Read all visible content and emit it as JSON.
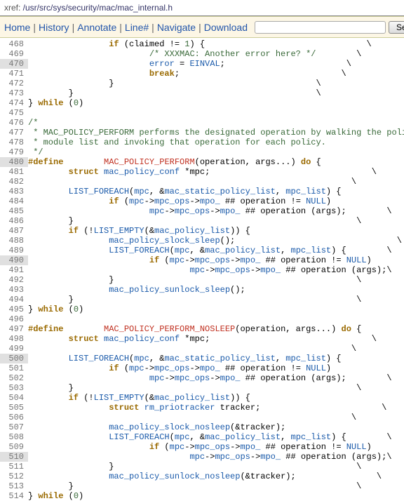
{
  "xref_label": "xref: ",
  "xref_path": "/usr/src/sys/security/mac/mac_internal.h",
  "nav": {
    "home": "Home",
    "history": "History",
    "annotate": "Annotate",
    "linenum": "Line#",
    "navigate": "Navigate",
    "download": "Download",
    "search_btn": "Search",
    "search_placeholder": ""
  },
  "highlight_lines": [
    470,
    480,
    490,
    500,
    510
  ],
  "lines": [
    {
      "n": 468,
      "segs": [
        {
          "t": "\t\t",
          "c": "d"
        },
        {
          "t": "if",
          "c": "k"
        },
        {
          "t": " (claimed != ",
          "c": "d"
        },
        {
          "t": "1",
          "c": "n"
        },
        {
          "t": ") {\t\t\t\t\\",
          "c": "d"
        }
      ]
    },
    {
      "n": 469,
      "segs": [
        {
          "t": "\t\t\t",
          "c": "d"
        },
        {
          "t": "/* XXXMAC: Another error here? */",
          "c": "c"
        },
        {
          "t": "\t\\",
          "c": "d"
        }
      ]
    },
    {
      "n": 470,
      "segs": [
        {
          "t": "\t\t\t",
          "c": "d"
        },
        {
          "t": "error",
          "c": "id"
        },
        {
          "t": " = ",
          "c": "d"
        },
        {
          "t": "EINVAL",
          "c": "id"
        },
        {
          "t": ";\t\t\t\\",
          "c": "d"
        }
      ]
    },
    {
      "n": 471,
      "segs": [
        {
          "t": "\t\t\t",
          "c": "d"
        },
        {
          "t": "break",
          "c": "k"
        },
        {
          "t": ";\t\t\t\t\\",
          "c": "d"
        }
      ]
    },
    {
      "n": 472,
      "segs": [
        {
          "t": "\t\t}\t\t\t\t\t\\",
          "c": "d"
        }
      ]
    },
    {
      "n": 473,
      "segs": [
        {
          "t": "\t}\t\t\t\t\t\t\\",
          "c": "d"
        }
      ]
    },
    {
      "n": 474,
      "segs": [
        {
          "t": "} ",
          "c": "d"
        },
        {
          "t": "while",
          "c": "k"
        },
        {
          "t": " (",
          "c": "d"
        },
        {
          "t": "0",
          "c": "n"
        },
        {
          "t": ")",
          "c": "d"
        }
      ]
    },
    {
      "n": 475,
      "segs": [
        {
          "t": "",
          "c": "d"
        }
      ]
    },
    {
      "n": 476,
      "segs": [
        {
          "t": "/*",
          "c": "c"
        }
      ]
    },
    {
      "n": 477,
      "segs": [
        {
          "t": " * MAC_POLICY_PERFORM performs the designated operation by walking the policy",
          "c": "c"
        }
      ]
    },
    {
      "n": 478,
      "segs": [
        {
          "t": " * module list and invoking that operation for each policy.",
          "c": "c"
        }
      ]
    },
    {
      "n": 479,
      "segs": [
        {
          "t": " */",
          "c": "c"
        }
      ]
    },
    {
      "n": 480,
      "segs": [
        {
          "t": "#",
          "c": "k"
        },
        {
          "t": "define",
          "c": "k"
        },
        {
          "t": "\t",
          "c": "d"
        },
        {
          "t": "MAC_POLICY_PERFORM",
          "c": "m"
        },
        {
          "t": "(operation, args...) ",
          "c": "d"
        },
        {
          "t": "do",
          "c": "k"
        },
        {
          "t": " {\t\t\t\\",
          "c": "d"
        }
      ]
    },
    {
      "n": 481,
      "segs": [
        {
          "t": "\t",
          "c": "d"
        },
        {
          "t": "struct",
          "c": "k"
        },
        {
          "t": " ",
          "c": "d"
        },
        {
          "t": "mac_policy_conf",
          "c": "id"
        },
        {
          "t": " *mpc;\t\t\t\t\\",
          "c": "d"
        }
      ]
    },
    {
      "n": 482,
      "segs": [
        {
          "t": "\t\t\t\t\t\t\t\t\\",
          "c": "d"
        }
      ]
    },
    {
      "n": 483,
      "segs": [
        {
          "t": "\t",
          "c": "d"
        },
        {
          "t": "LIST_FOREACH",
          "c": "id"
        },
        {
          "t": "(",
          "c": "d"
        },
        {
          "t": "mpc",
          "c": "id"
        },
        {
          "t": ", &",
          "c": "d"
        },
        {
          "t": "mac_static_policy_list",
          "c": "id"
        },
        {
          "t": ", ",
          "c": "d"
        },
        {
          "t": "mpc_list",
          "c": "id"
        },
        {
          "t": ") {\t\t\\",
          "c": "d"
        }
      ]
    },
    {
      "n": 484,
      "segs": [
        {
          "t": "\t\t",
          "c": "d"
        },
        {
          "t": "if",
          "c": "k"
        },
        {
          "t": " (",
          "c": "d"
        },
        {
          "t": "mpc",
          "c": "id"
        },
        {
          "t": "->",
          "c": "d"
        },
        {
          "t": "mpc_ops",
          "c": "id"
        },
        {
          "t": "->",
          "c": "d"
        },
        {
          "t": "mpo_",
          "c": "id"
        },
        {
          "t": " ## operation != ",
          "c": "d"
        },
        {
          "t": "NULL",
          "c": "id"
        },
        {
          "t": ")\t\t\\",
          "c": "d"
        }
      ]
    },
    {
      "n": 485,
      "segs": [
        {
          "t": "\t\t\t",
          "c": "d"
        },
        {
          "t": "mpc",
          "c": "id"
        },
        {
          "t": "->",
          "c": "d"
        },
        {
          "t": "mpc_ops",
          "c": "id"
        },
        {
          "t": "->",
          "c": "d"
        },
        {
          "t": "mpo_",
          "c": "id"
        },
        {
          "t": " ## operation (args);\t\\",
          "c": "d"
        }
      ]
    },
    {
      "n": 486,
      "segs": [
        {
          "t": "\t}\t\t\t\t\t\t\t\\",
          "c": "d"
        }
      ]
    },
    {
      "n": 487,
      "segs": [
        {
          "t": "\t",
          "c": "d"
        },
        {
          "t": "if",
          "c": "k"
        },
        {
          "t": " (!",
          "c": "d"
        },
        {
          "t": "LIST_EMPTY",
          "c": "id"
        },
        {
          "t": "(&",
          "c": "d"
        },
        {
          "t": "mac_policy_list",
          "c": "id"
        },
        {
          "t": ")) {\t\t\t\t\\",
          "c": "d"
        }
      ]
    },
    {
      "n": 488,
      "segs": [
        {
          "t": "\t\t",
          "c": "d"
        },
        {
          "t": "mac_policy_slock_sleep",
          "c": "id"
        },
        {
          "t": "();\t\t\t\t\\",
          "c": "d"
        }
      ]
    },
    {
      "n": 489,
      "segs": [
        {
          "t": "\t\t",
          "c": "d"
        },
        {
          "t": "LIST_FOREACH",
          "c": "id"
        },
        {
          "t": "(",
          "c": "d"
        },
        {
          "t": "mpc",
          "c": "id"
        },
        {
          "t": ", &",
          "c": "d"
        },
        {
          "t": "mac_policy_list",
          "c": "id"
        },
        {
          "t": ", ",
          "c": "d"
        },
        {
          "t": "mpc_list",
          "c": "id"
        },
        {
          "t": ") {\t\\",
          "c": "d"
        }
      ]
    },
    {
      "n": 490,
      "segs": [
        {
          "t": "\t\t\t",
          "c": "d"
        },
        {
          "t": "if",
          "c": "k"
        },
        {
          "t": " (",
          "c": "d"
        },
        {
          "t": "mpc",
          "c": "id"
        },
        {
          "t": "->",
          "c": "d"
        },
        {
          "t": "mpc_ops",
          "c": "id"
        },
        {
          "t": "->",
          "c": "d"
        },
        {
          "t": "mpo_",
          "c": "id"
        },
        {
          "t": " ## operation != ",
          "c": "d"
        },
        {
          "t": "NULL",
          "c": "id"
        },
        {
          "t": ")\t\\",
          "c": "d"
        }
      ]
    },
    {
      "n": 491,
      "segs": [
        {
          "t": "\t\t\t\t",
          "c": "d"
        },
        {
          "t": "mpc",
          "c": "id"
        },
        {
          "t": "->",
          "c": "d"
        },
        {
          "t": "mpc_ops",
          "c": "id"
        },
        {
          "t": "->",
          "c": "d"
        },
        {
          "t": "mpo_",
          "c": "id"
        },
        {
          "t": " ## operation (args);\\",
          "c": "d"
        }
      ]
    },
    {
      "n": 492,
      "segs": [
        {
          "t": "\t\t}\t\t\t\t\t\t\\",
          "c": "d"
        }
      ]
    },
    {
      "n": 493,
      "segs": [
        {
          "t": "\t\t",
          "c": "d"
        },
        {
          "t": "mac_policy_sunlock_sleep",
          "c": "id"
        },
        {
          "t": "();\t\t\t\t\\",
          "c": "d"
        }
      ]
    },
    {
      "n": 494,
      "segs": [
        {
          "t": "\t}\t\t\t\t\t\t\t\\",
          "c": "d"
        }
      ]
    },
    {
      "n": 495,
      "segs": [
        {
          "t": "} ",
          "c": "d"
        },
        {
          "t": "while",
          "c": "k"
        },
        {
          "t": " (",
          "c": "d"
        },
        {
          "t": "0",
          "c": "n"
        },
        {
          "t": ")",
          "c": "d"
        }
      ]
    },
    {
      "n": 496,
      "segs": [
        {
          "t": "",
          "c": "d"
        }
      ]
    },
    {
      "n": 497,
      "segs": [
        {
          "t": "#",
          "c": "k"
        },
        {
          "t": "define",
          "c": "k"
        },
        {
          "t": "\t",
          "c": "d"
        },
        {
          "t": "MAC_POLICY_PERFORM_NOSLEEP",
          "c": "m"
        },
        {
          "t": "(operation, args...) ",
          "c": "d"
        },
        {
          "t": "do",
          "c": "k"
        },
        {
          "t": " {\t\t\\",
          "c": "d"
        }
      ]
    },
    {
      "n": 498,
      "segs": [
        {
          "t": "\t",
          "c": "d"
        },
        {
          "t": "struct",
          "c": "k"
        },
        {
          "t": " ",
          "c": "d"
        },
        {
          "t": "mac_policy_conf",
          "c": "id"
        },
        {
          "t": " *mpc;\t\t\t\t\\",
          "c": "d"
        }
      ]
    },
    {
      "n": 499,
      "segs": [
        {
          "t": "\t\t\t\t\t\t\t\t\\",
          "c": "d"
        }
      ]
    },
    {
      "n": 500,
      "segs": [
        {
          "t": "\t",
          "c": "d"
        },
        {
          "t": "LIST_FOREACH",
          "c": "id"
        },
        {
          "t": "(",
          "c": "d"
        },
        {
          "t": "mpc",
          "c": "id"
        },
        {
          "t": ", &",
          "c": "d"
        },
        {
          "t": "mac_static_policy_list",
          "c": "id"
        },
        {
          "t": ", ",
          "c": "d"
        },
        {
          "t": "mpc_list",
          "c": "id"
        },
        {
          "t": ") {\t\t\\",
          "c": "d"
        }
      ]
    },
    {
      "n": 501,
      "segs": [
        {
          "t": "\t\t",
          "c": "d"
        },
        {
          "t": "if",
          "c": "k"
        },
        {
          "t": " (",
          "c": "d"
        },
        {
          "t": "mpc",
          "c": "id"
        },
        {
          "t": "->",
          "c": "d"
        },
        {
          "t": "mpc_ops",
          "c": "id"
        },
        {
          "t": "->",
          "c": "d"
        },
        {
          "t": "mpo_",
          "c": "id"
        },
        {
          "t": " ## operation != ",
          "c": "d"
        },
        {
          "t": "NULL",
          "c": "id"
        },
        {
          "t": ")\t\t\\",
          "c": "d"
        }
      ]
    },
    {
      "n": 502,
      "segs": [
        {
          "t": "\t\t\t",
          "c": "d"
        },
        {
          "t": "mpc",
          "c": "id"
        },
        {
          "t": "->",
          "c": "d"
        },
        {
          "t": "mpc_ops",
          "c": "id"
        },
        {
          "t": "->",
          "c": "d"
        },
        {
          "t": "mpo_",
          "c": "id"
        },
        {
          "t": " ## operation (args);\t\\",
          "c": "d"
        }
      ]
    },
    {
      "n": 503,
      "segs": [
        {
          "t": "\t}\t\t\t\t\t\t\t\\",
          "c": "d"
        }
      ]
    },
    {
      "n": 504,
      "segs": [
        {
          "t": "\t",
          "c": "d"
        },
        {
          "t": "if",
          "c": "k"
        },
        {
          "t": " (!",
          "c": "d"
        },
        {
          "t": "LIST_EMPTY",
          "c": "id"
        },
        {
          "t": "(&",
          "c": "d"
        },
        {
          "t": "mac_policy_list",
          "c": "id"
        },
        {
          "t": ")) {\t\t\t\t\\",
          "c": "d"
        }
      ]
    },
    {
      "n": 505,
      "segs": [
        {
          "t": "\t\t",
          "c": "d"
        },
        {
          "t": "struct",
          "c": "k"
        },
        {
          "t": " ",
          "c": "d"
        },
        {
          "t": "rm_priotracker",
          "c": "id"
        },
        {
          "t": " tracker;\t\t\t\\",
          "c": "d"
        }
      ]
    },
    {
      "n": 506,
      "segs": [
        {
          "t": "\t\t\t\t\t\t\t\t\\",
          "c": "d"
        }
      ]
    },
    {
      "n": 507,
      "segs": [
        {
          "t": "\t\t",
          "c": "d"
        },
        {
          "t": "mac_policy_slock_nosleep",
          "c": "id"
        },
        {
          "t": "(&tracker);\t\t\t\\",
          "c": "d"
        }
      ]
    },
    {
      "n": 508,
      "segs": [
        {
          "t": "\t\t",
          "c": "d"
        },
        {
          "t": "LIST_FOREACH",
          "c": "id"
        },
        {
          "t": "(",
          "c": "d"
        },
        {
          "t": "mpc",
          "c": "id"
        },
        {
          "t": ", &",
          "c": "d"
        },
        {
          "t": "mac_policy_list",
          "c": "id"
        },
        {
          "t": ", ",
          "c": "d"
        },
        {
          "t": "mpc_list",
          "c": "id"
        },
        {
          "t": ") {\t\\",
          "c": "d"
        }
      ]
    },
    {
      "n": 509,
      "segs": [
        {
          "t": "\t\t\t",
          "c": "d"
        },
        {
          "t": "if",
          "c": "k"
        },
        {
          "t": " (",
          "c": "d"
        },
        {
          "t": "mpc",
          "c": "id"
        },
        {
          "t": "->",
          "c": "d"
        },
        {
          "t": "mpc_ops",
          "c": "id"
        },
        {
          "t": "->",
          "c": "d"
        },
        {
          "t": "mpo_",
          "c": "id"
        },
        {
          "t": " ## operation != ",
          "c": "d"
        },
        {
          "t": "NULL",
          "c": "id"
        },
        {
          "t": ")\t\\",
          "c": "d"
        }
      ]
    },
    {
      "n": 510,
      "segs": [
        {
          "t": "\t\t\t\t",
          "c": "d"
        },
        {
          "t": "mpc",
          "c": "id"
        },
        {
          "t": "->",
          "c": "d"
        },
        {
          "t": "mpc_ops",
          "c": "id"
        },
        {
          "t": "->",
          "c": "d"
        },
        {
          "t": "mpo_",
          "c": "id"
        },
        {
          "t": " ## operation (args);\\",
          "c": "d"
        }
      ]
    },
    {
      "n": 511,
      "segs": [
        {
          "t": "\t\t}\t\t\t\t\t\t\\",
          "c": "d"
        }
      ]
    },
    {
      "n": 512,
      "segs": [
        {
          "t": "\t\t",
          "c": "d"
        },
        {
          "t": "mac_policy_sunlock_nosleep",
          "c": "id"
        },
        {
          "t": "(&tracker);\t\t\\",
          "c": "d"
        }
      ]
    },
    {
      "n": 513,
      "segs": [
        {
          "t": "\t}\t\t\t\t\t\t\t\\",
          "c": "d"
        }
      ]
    },
    {
      "n": 514,
      "segs": [
        {
          "t": "} ",
          "c": "d"
        },
        {
          "t": "while",
          "c": "k"
        },
        {
          "t": " (",
          "c": "d"
        },
        {
          "t": "0",
          "c": "n"
        },
        {
          "t": ")",
          "c": "d"
        }
      ]
    }
  ]
}
